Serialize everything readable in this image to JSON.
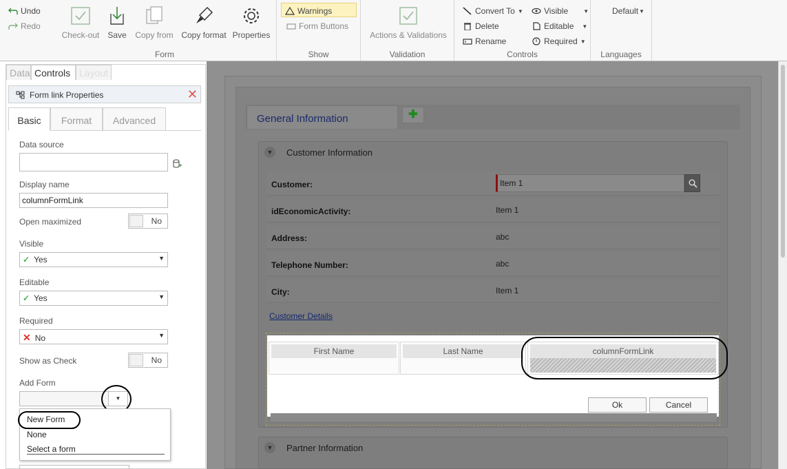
{
  "ribbon": {
    "undo": "Undo",
    "redo": "Redo",
    "checkout": "Check-out",
    "save": "Save",
    "copy_from": "Copy from",
    "copy_format": "Copy format",
    "properties": "Properties",
    "form_group": "Form",
    "warnings": "Warnings",
    "form_buttons": "Form Buttons",
    "show_group": "Show",
    "actions_validations": "Actions & Validations",
    "validation_group": "Validation",
    "convert_to": "Convert To",
    "delete": "Delete",
    "rename": "Rename",
    "visible": "Visible",
    "editable": "Editable",
    "required": "Required",
    "controls_group": "Controls",
    "language_value": "Default",
    "languages_group": "Languages"
  },
  "left": {
    "tabs": [
      "Data",
      "Controls",
      "Layout"
    ],
    "prop_title": "Form link Properties",
    "prop_tabs": [
      "Basic",
      "Format",
      "Advanced"
    ],
    "data_source_label": "Data source",
    "data_source_value": "",
    "display_name_label": "Display name",
    "display_name_value": "columnFormLink",
    "open_max_label": "Open maximized",
    "open_max_value": "No",
    "visible_label": "Visible",
    "visible_value": "Yes",
    "editable_label": "Editable",
    "editable_value": "Yes",
    "required_label": "Required",
    "required_value": "No",
    "show_check_label": "Show as Check",
    "show_check_value": "No",
    "add_form_label": "Add Form",
    "dropdown_items": [
      "New Form",
      "None",
      "Select a form"
    ]
  },
  "designer": {
    "tab_general": "General Information",
    "section_customer": "Customer Information",
    "fields": [
      {
        "label": "Customer:",
        "value": "Item 1"
      },
      {
        "label": "idEconomicActivity:",
        "value": "Item 1"
      },
      {
        "label": "Address:",
        "value": "abc"
      },
      {
        "label": "Telephone Number:",
        "value": "abc"
      },
      {
        "label": "City:",
        "value": "Item 1"
      }
    ],
    "customer_details_link": "Customer Details",
    "columns": [
      "First Name",
      "Last Name",
      "columnFormLink"
    ],
    "ok": "Ok",
    "cancel": "Cancel",
    "section_partner": "Partner Information"
  }
}
